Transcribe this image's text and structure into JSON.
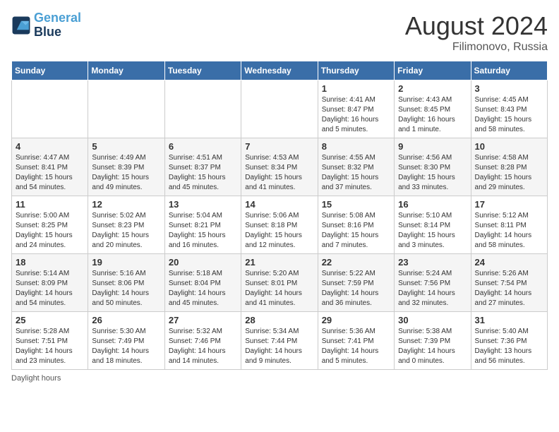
{
  "header": {
    "logo_line1": "General",
    "logo_line2": "Blue",
    "month": "August 2024",
    "location": "Filimonovo, Russia"
  },
  "weekdays": [
    "Sunday",
    "Monday",
    "Tuesday",
    "Wednesday",
    "Thursday",
    "Friday",
    "Saturday"
  ],
  "weeks": [
    [
      {
        "day": "",
        "info": ""
      },
      {
        "day": "",
        "info": ""
      },
      {
        "day": "",
        "info": ""
      },
      {
        "day": "",
        "info": ""
      },
      {
        "day": "1",
        "info": "Sunrise: 4:41 AM\nSunset: 8:47 PM\nDaylight: 16 hours\nand 5 minutes."
      },
      {
        "day": "2",
        "info": "Sunrise: 4:43 AM\nSunset: 8:45 PM\nDaylight: 16 hours\nand 1 minute."
      },
      {
        "day": "3",
        "info": "Sunrise: 4:45 AM\nSunset: 8:43 PM\nDaylight: 15 hours\nand 58 minutes."
      }
    ],
    [
      {
        "day": "4",
        "info": "Sunrise: 4:47 AM\nSunset: 8:41 PM\nDaylight: 15 hours\nand 54 minutes."
      },
      {
        "day": "5",
        "info": "Sunrise: 4:49 AM\nSunset: 8:39 PM\nDaylight: 15 hours\nand 49 minutes."
      },
      {
        "day": "6",
        "info": "Sunrise: 4:51 AM\nSunset: 8:37 PM\nDaylight: 15 hours\nand 45 minutes."
      },
      {
        "day": "7",
        "info": "Sunrise: 4:53 AM\nSunset: 8:34 PM\nDaylight: 15 hours\nand 41 minutes."
      },
      {
        "day": "8",
        "info": "Sunrise: 4:55 AM\nSunset: 8:32 PM\nDaylight: 15 hours\nand 37 minutes."
      },
      {
        "day": "9",
        "info": "Sunrise: 4:56 AM\nSunset: 8:30 PM\nDaylight: 15 hours\nand 33 minutes."
      },
      {
        "day": "10",
        "info": "Sunrise: 4:58 AM\nSunset: 8:28 PM\nDaylight: 15 hours\nand 29 minutes."
      }
    ],
    [
      {
        "day": "11",
        "info": "Sunrise: 5:00 AM\nSunset: 8:25 PM\nDaylight: 15 hours\nand 24 minutes."
      },
      {
        "day": "12",
        "info": "Sunrise: 5:02 AM\nSunset: 8:23 PM\nDaylight: 15 hours\nand 20 minutes."
      },
      {
        "day": "13",
        "info": "Sunrise: 5:04 AM\nSunset: 8:21 PM\nDaylight: 15 hours\nand 16 minutes."
      },
      {
        "day": "14",
        "info": "Sunrise: 5:06 AM\nSunset: 8:18 PM\nDaylight: 15 hours\nand 12 minutes."
      },
      {
        "day": "15",
        "info": "Sunrise: 5:08 AM\nSunset: 8:16 PM\nDaylight: 15 hours\nand 7 minutes."
      },
      {
        "day": "16",
        "info": "Sunrise: 5:10 AM\nSunset: 8:14 PM\nDaylight: 15 hours\nand 3 minutes."
      },
      {
        "day": "17",
        "info": "Sunrise: 5:12 AM\nSunset: 8:11 PM\nDaylight: 14 hours\nand 58 minutes."
      }
    ],
    [
      {
        "day": "18",
        "info": "Sunrise: 5:14 AM\nSunset: 8:09 PM\nDaylight: 14 hours\nand 54 minutes."
      },
      {
        "day": "19",
        "info": "Sunrise: 5:16 AM\nSunset: 8:06 PM\nDaylight: 14 hours\nand 50 minutes."
      },
      {
        "day": "20",
        "info": "Sunrise: 5:18 AM\nSunset: 8:04 PM\nDaylight: 14 hours\nand 45 minutes."
      },
      {
        "day": "21",
        "info": "Sunrise: 5:20 AM\nSunset: 8:01 PM\nDaylight: 14 hours\nand 41 minutes."
      },
      {
        "day": "22",
        "info": "Sunrise: 5:22 AM\nSunset: 7:59 PM\nDaylight: 14 hours\nand 36 minutes."
      },
      {
        "day": "23",
        "info": "Sunrise: 5:24 AM\nSunset: 7:56 PM\nDaylight: 14 hours\nand 32 minutes."
      },
      {
        "day": "24",
        "info": "Sunrise: 5:26 AM\nSunset: 7:54 PM\nDaylight: 14 hours\nand 27 minutes."
      }
    ],
    [
      {
        "day": "25",
        "info": "Sunrise: 5:28 AM\nSunset: 7:51 PM\nDaylight: 14 hours\nand 23 minutes."
      },
      {
        "day": "26",
        "info": "Sunrise: 5:30 AM\nSunset: 7:49 PM\nDaylight: 14 hours\nand 18 minutes."
      },
      {
        "day": "27",
        "info": "Sunrise: 5:32 AM\nSunset: 7:46 PM\nDaylight: 14 hours\nand 14 minutes."
      },
      {
        "day": "28",
        "info": "Sunrise: 5:34 AM\nSunset: 7:44 PM\nDaylight: 14 hours\nand 9 minutes."
      },
      {
        "day": "29",
        "info": "Sunrise: 5:36 AM\nSunset: 7:41 PM\nDaylight: 14 hours\nand 5 minutes."
      },
      {
        "day": "30",
        "info": "Sunrise: 5:38 AM\nSunset: 7:39 PM\nDaylight: 14 hours\nand 0 minutes."
      },
      {
        "day": "31",
        "info": "Sunrise: 5:40 AM\nSunset: 7:36 PM\nDaylight: 13 hours\nand 56 minutes."
      }
    ]
  ],
  "footer": {
    "note": "Daylight hours"
  }
}
